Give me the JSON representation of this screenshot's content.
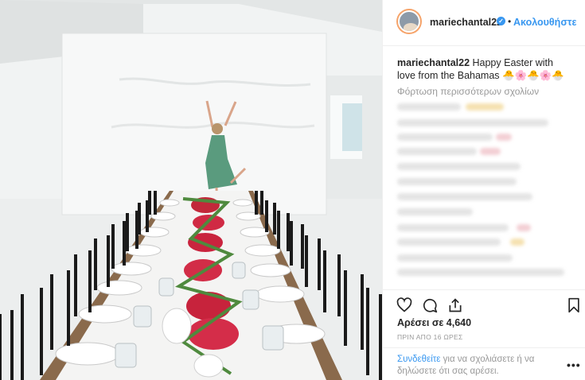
{
  "post": {
    "username": "mariechantal22",
    "follow_label": "Ακολουθήστε",
    "dot": "•",
    "verified_mark": "✓",
    "caption_user": "mariechantal22",
    "caption_text": " Happy Easter with love from the Bahamas 🐣🌸🐣🌸🐣",
    "load_more": "Φόρτωση περισσότερων σχολίων",
    "likes": "Αρέσει σε 4,640",
    "time": "ΠΡΙΝ ΑΠΟ 16 ΩΡΕΣ",
    "login_link": "Συνδεθείτε",
    "login_text": " για να σχολιάσετε ή να δηλώσετε ότι σας αρέσει.",
    "more": "•••"
  },
  "icons": {
    "like": "heart-icon",
    "comment": "comment-icon",
    "share": "share-icon",
    "save": "bookmark-icon",
    "verified": "verified-badge-icon",
    "more": "more-options-icon"
  },
  "colors": {
    "accent": "#3897f0",
    "text": "#262626",
    "muted": "#999999",
    "border": "#efefef"
  },
  "photo": {
    "subject": "woman in green dress jumping on white wall backdrop behind long dining table with pink flowers and black chairs"
  }
}
